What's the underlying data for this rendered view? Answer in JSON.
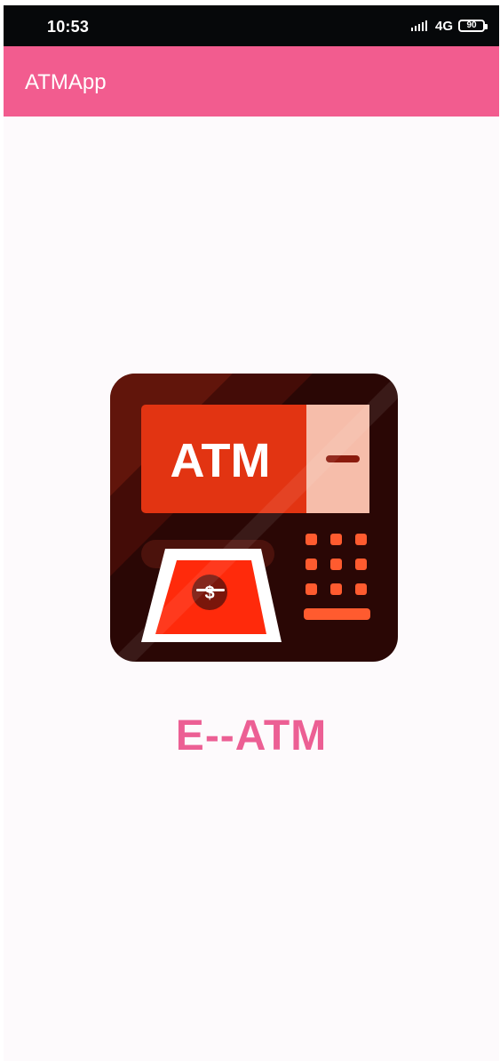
{
  "status_bar": {
    "time": "10:53",
    "network": "4G",
    "battery": "90",
    "signal_icon": "signal-icon",
    "battery_icon": "battery-icon"
  },
  "app_bar": {
    "title": "ATMApp"
  },
  "main": {
    "logo_icon": "atm-machine-icon",
    "logo_label": "ATM",
    "title": "E--ATM"
  },
  "colors": {
    "app_bar": "#f25c8f",
    "status_bar": "#06080a",
    "title_text": "#ec5f94",
    "logo_dark": "#2a0705",
    "logo_red": "#e23412",
    "logo_orange": "#ff5b2f"
  }
}
